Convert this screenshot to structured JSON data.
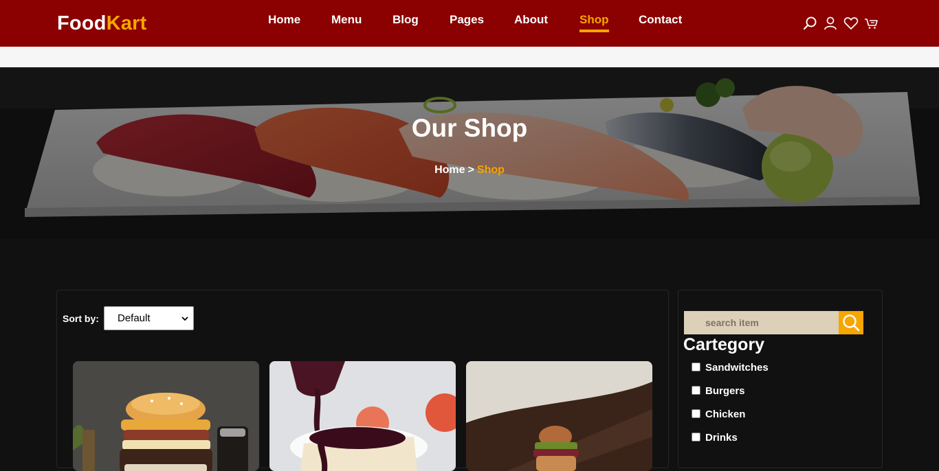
{
  "brand": {
    "name_part1": "Food",
    "name_part2": "Kart",
    "accent_color": "#f7a600",
    "header_bg": "#8b0000"
  },
  "nav": {
    "items": [
      {
        "label": "Home"
      },
      {
        "label": "Menu"
      },
      {
        "label": "Blog"
      },
      {
        "label": "Pages"
      },
      {
        "label": "About"
      },
      {
        "label": "Shop",
        "active": true
      },
      {
        "label": "Contact"
      }
    ],
    "icons": [
      "search-icon",
      "user-icon",
      "heart-icon",
      "cart-icon"
    ]
  },
  "hero": {
    "title": "Our Shop",
    "breadcrumb": {
      "home": "Home",
      "separator": ">",
      "current": "Shop"
    }
  },
  "shop": {
    "sort_label": "Sort by:",
    "sort_selected": "Default",
    "products": [
      {
        "image": "burger-photo"
      },
      {
        "image": "cheesecake-photo"
      },
      {
        "image": "slider-burger-photo"
      }
    ]
  },
  "sidebar": {
    "search_placeholder": "search item",
    "category_title": "Cartegory",
    "categories": [
      "Sandwitches",
      "Burgers",
      "Chicken",
      "Drinks"
    ]
  }
}
